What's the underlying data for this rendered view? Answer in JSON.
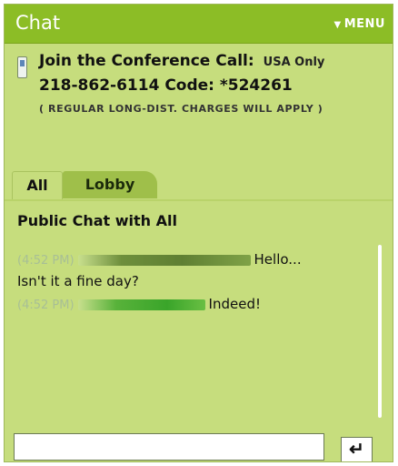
{
  "header": {
    "title": "Chat",
    "menu_label": "MENU",
    "menu_icon": "triangle-down-icon"
  },
  "conference": {
    "title": "Join the Conference Call:",
    "region": "USA Only",
    "number": "218-862-6114 Code: *524261",
    "note": "( REGULAR LONG-DIST. CHARGES WILL APPLY )",
    "icon": "phone-icon"
  },
  "tabs": [
    {
      "label": "All",
      "active": true
    },
    {
      "label": "Lobby",
      "active": false
    }
  ],
  "chat": {
    "heading": "Public Chat with All",
    "messages": [
      {
        "time": "(4:52 PM)",
        "sender_redacted": true,
        "text": "Hello..."
      },
      {
        "continuation": "Isn't it a fine day?"
      },
      {
        "time": "(4:52 PM)",
        "sender_redacted": true,
        "text": "Indeed!"
      }
    ]
  },
  "input": {
    "value": "",
    "placeholder": ""
  },
  "send_button": {
    "icon": "return-arrow-icon",
    "glyph": "↵"
  },
  "colors": {
    "panel": "#c6dd7d",
    "titlebar": "#8cbd26",
    "time_text": "#a8bf95"
  }
}
